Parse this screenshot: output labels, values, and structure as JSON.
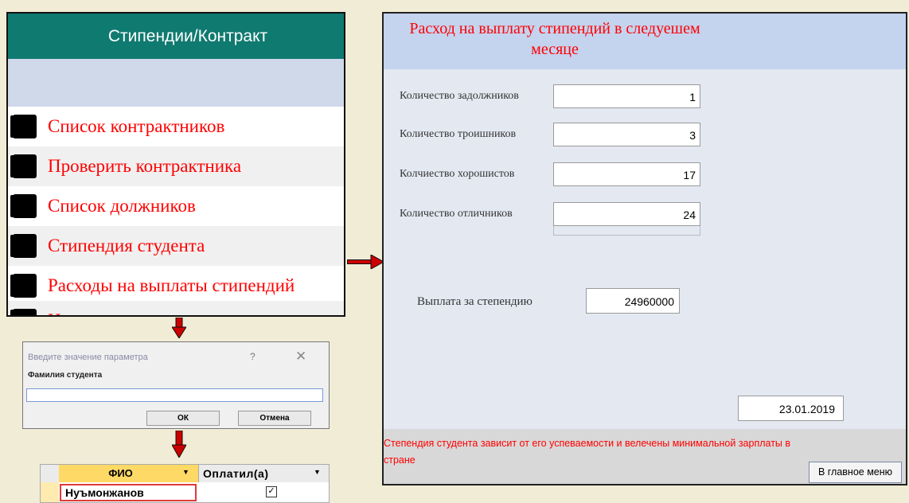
{
  "menu": {
    "title": "Стипендии/Контракт",
    "items": [
      {
        "label": "Список контрактников"
      },
      {
        "label": "Проверить контрактника"
      },
      {
        "label": "Список должников"
      },
      {
        "label": "Стипендия студента"
      },
      {
        "label": "Расходы на выплаты стипендий"
      },
      {
        "label": "Назад"
      }
    ]
  },
  "form": {
    "title": "Расход на выплату стипендий в следуешем месяце",
    "fields": [
      {
        "label": "Количество задолжников",
        "value": "1"
      },
      {
        "label": "Количество троишников",
        "value": "3"
      },
      {
        "label": "Колчиество хорошистов",
        "value": "17"
      },
      {
        "label": "Количество отличников",
        "value": "24"
      }
    ],
    "payment_label": "Выплата за степендию",
    "payment_value": "24960000",
    "date": "23.01.2019",
    "note": "Степендия студента зависит от его успеваемости и велечены минимальной зарплаты в стране",
    "main_menu_button": "В главное меню"
  },
  "dialog": {
    "title": "Введите значение параметра",
    "help": "?",
    "close": "✕",
    "prompt": "Фамилия студента",
    "input_value": "",
    "ok": "ОК",
    "cancel": "Отмена"
  },
  "grid": {
    "columns": [
      "ФИО",
      "Оплатил(а)"
    ],
    "rows": [
      {
        "fio": "Нуъмонжанов",
        "paid": true
      }
    ]
  },
  "colors": {
    "menu_header": "#0f7a70",
    "accent_text": "#ff0000",
    "form_header": "#c4d3ee",
    "column_highlight": "#ffd966"
  }
}
